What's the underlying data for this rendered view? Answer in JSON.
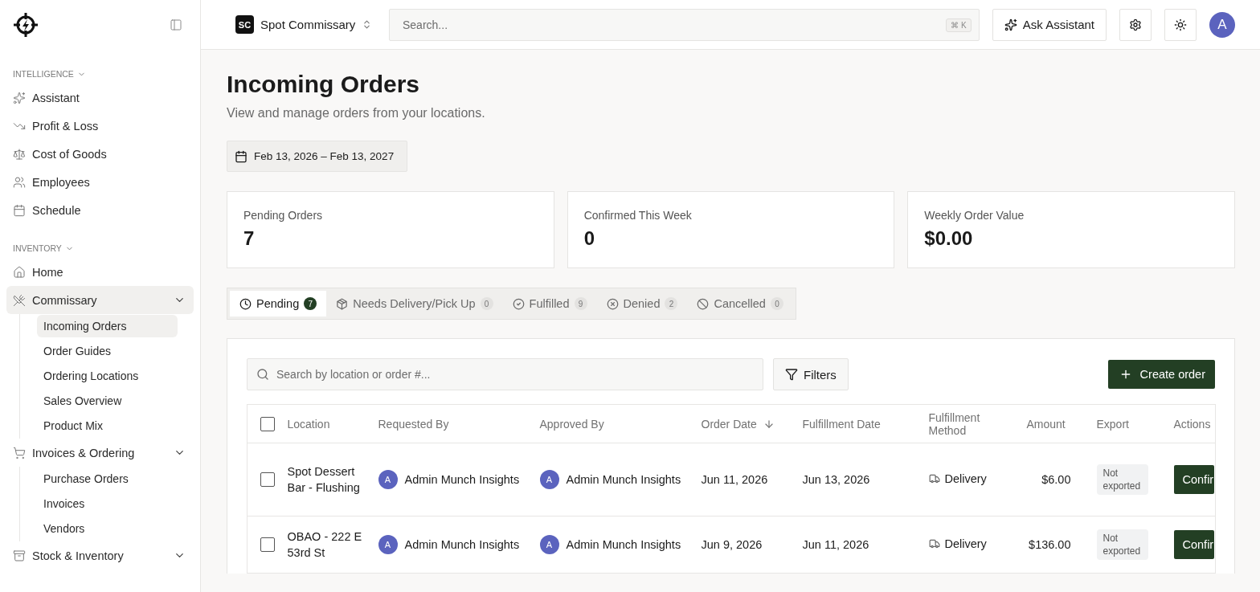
{
  "sidebar": {
    "sections": [
      {
        "label": "INTELLIGENCE",
        "items": [
          {
            "label": "Assistant",
            "selected": false
          },
          {
            "label": "Profit & Loss",
            "selected": false
          },
          {
            "label": "Cost of Goods",
            "selected": false
          },
          {
            "label": "Employees",
            "selected": false
          },
          {
            "label": "Schedule",
            "selected": false
          }
        ]
      },
      {
        "label": "INVENTORY",
        "items": [
          {
            "label": "Home",
            "selected": false,
            "submenu": false
          },
          {
            "label": "Commissary",
            "selected": true,
            "submenu": true,
            "children": [
              {
                "label": "Incoming Orders",
                "selected": true
              },
              {
                "label": "Order Guides",
                "selected": false
              },
              {
                "label": "Ordering Locations",
                "selected": false
              },
              {
                "label": "Sales Overview",
                "selected": false
              },
              {
                "label": "Product Mix",
                "selected": false
              }
            ]
          },
          {
            "label": "Invoices & Ordering",
            "selected": false,
            "submenu": true,
            "children": [
              {
                "label": "Purchase Orders",
                "selected": false
              },
              {
                "label": "Invoices",
                "selected": false
              },
              {
                "label": "Vendors",
                "selected": false
              }
            ]
          },
          {
            "label": "Stock & Inventory",
            "selected": false,
            "submenu": true
          }
        ]
      }
    ]
  },
  "topbar": {
    "org": {
      "initials": "SC",
      "name": "Spot Commissary"
    },
    "search": {
      "placeholder": "Search...",
      "shortcut": "⌘ K"
    },
    "assistant_button": "Ask Assistant",
    "avatar": "A"
  },
  "page": {
    "title": "Incoming Orders",
    "subtitle": "View and manage orders from your locations.",
    "date_range": "Feb 13, 2026 – Feb 13, 2027"
  },
  "stats": [
    {
      "label": "Pending Orders",
      "value": "7"
    },
    {
      "label": "Confirmed This Week",
      "value": "0"
    },
    {
      "label": "Weekly Order Value",
      "value": "$0.00"
    }
  ],
  "tabs": [
    {
      "label": "Pending",
      "count": "7",
      "selected": true
    },
    {
      "label": "Needs Delivery/Pick Up",
      "count": "0",
      "selected": false
    },
    {
      "label": "Fulfilled",
      "count": "9",
      "selected": false
    },
    {
      "label": "Denied",
      "count": "2",
      "selected": false
    },
    {
      "label": "Cancelled",
      "count": "0",
      "selected": false
    }
  ],
  "toolbar": {
    "search_placeholder": "Search by location or order #...",
    "filters": "Filters",
    "create": "Create order"
  },
  "table": {
    "select_all_checked": false,
    "columns": [
      {
        "label": "Location",
        "sorted": false
      },
      {
        "label": "Requested By",
        "sorted": false
      },
      {
        "label": "Approved By",
        "sorted": false
      },
      {
        "label": "Order Date",
        "sorted": true
      },
      {
        "label": "Fulfillment Date",
        "sorted": false
      },
      {
        "label": "Fulfillment Method",
        "sorted": false
      },
      {
        "label": "Amount",
        "sorted": false
      },
      {
        "label": "Export",
        "sorted": false
      },
      {
        "label": "Actions",
        "sorted": false
      }
    ],
    "rows": [
      {
        "checked": false,
        "location": "Spot Dessert Bar - Flushing",
        "requested_by": {
          "initial": "A",
          "name": "Admin Munch Insights"
        },
        "approved_by": {
          "initial": "A",
          "name": "Admin Munch Insights"
        },
        "order_date": "Jun 11, 2026",
        "fulfillment_date": "Jun 13, 2026",
        "method": "Delivery",
        "amount": "$6.00",
        "export": "Not exported",
        "action": "Confir"
      },
      {
        "checked": false,
        "location": "OBAO - 222 E 53rd St",
        "requested_by": {
          "initial": "A",
          "name": "Admin Munch Insights"
        },
        "approved_by": {
          "initial": "A",
          "name": "Admin Munch Insights"
        },
        "order_date": "Jun 9, 2026",
        "fulfillment_date": "Jun 11, 2026",
        "method": "Delivery",
        "amount": "$136.00",
        "export": "Not exported",
        "action": "Confir"
      }
    ]
  }
}
